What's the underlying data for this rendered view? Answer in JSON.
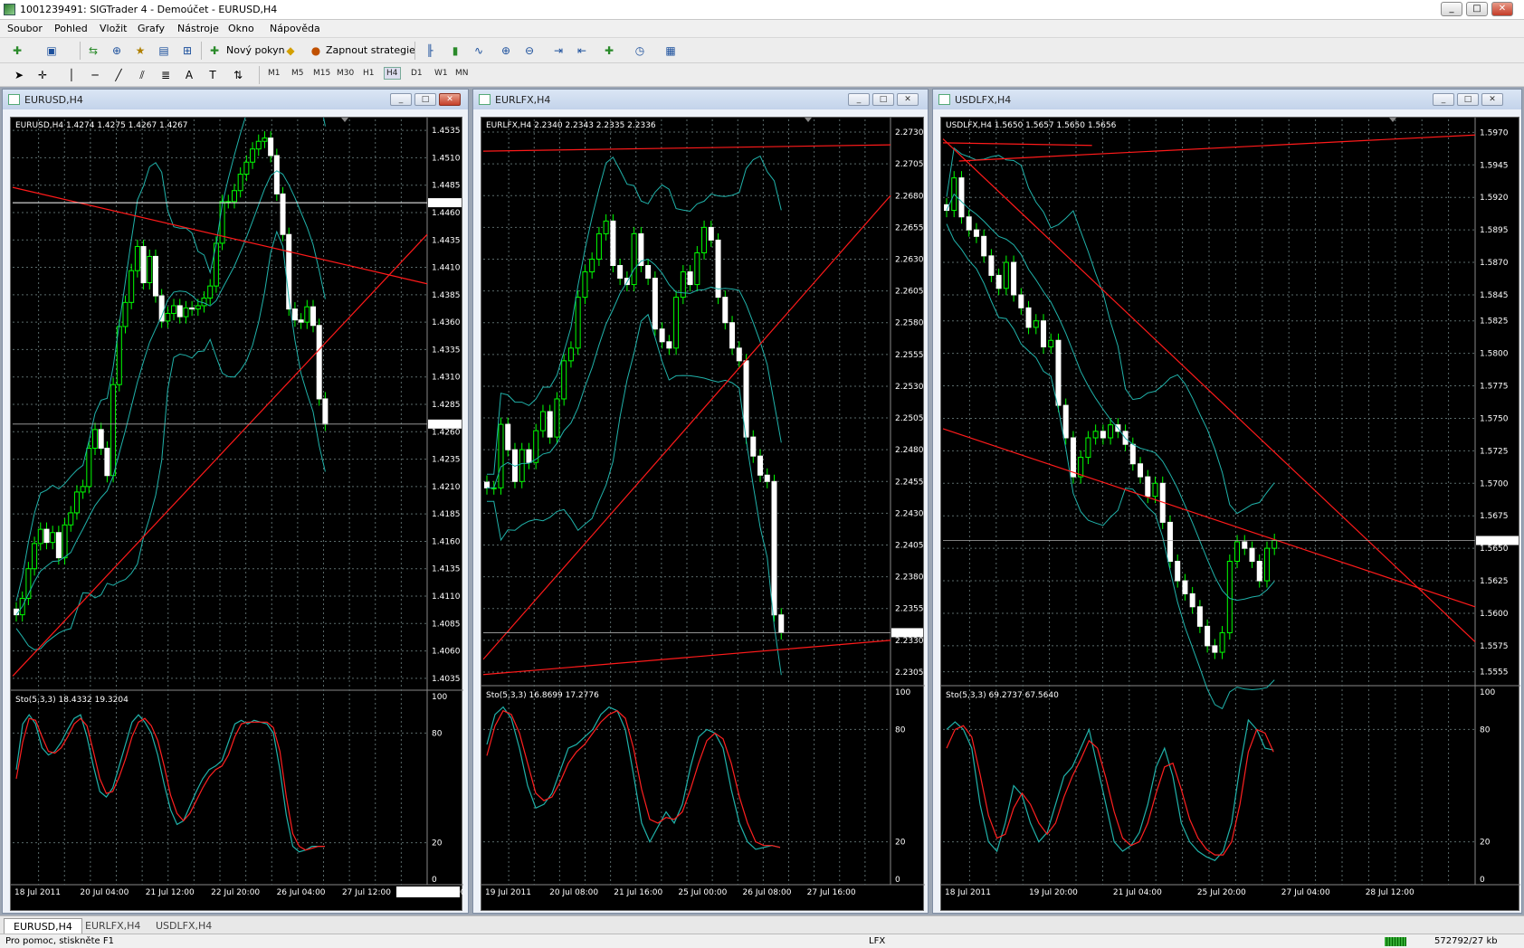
{
  "window": {
    "title": "1001239491: SIGTrader 4 - Demoúčet - EURUSD,H4",
    "min": "_",
    "max": "□",
    "close": "✕"
  },
  "menu": [
    "Soubor",
    "Pohled",
    "Vložit",
    "Grafy",
    "Nástroje",
    "Okno",
    "Nápověda"
  ],
  "toolbar": {
    "new_order": "Nový pokyn",
    "start_strategies": "Zapnout strategie",
    "timeframes": [
      "M1",
      "M5",
      "M15",
      "M30",
      "H1",
      "H4",
      "D1",
      "W1",
      "MN"
    ],
    "active_tf": "H4"
  },
  "charts": [
    {
      "caption": "EURUSD,H4",
      "info": "EURUSD,H4  1.4274 1.4275 1.4267 1.4267",
      "ylabels": [
        "1.4535",
        "1.4510",
        "1.4485",
        "1.4460",
        "1.4435",
        "1.4410",
        "1.4385",
        "1.4360",
        "1.4335",
        "1.4310",
        "1.4285",
        "1.4260",
        "1.4235",
        "1.4210",
        "1.4185",
        "1.4160",
        "1.4135",
        "1.4110",
        "1.4085",
        "1.4060",
        "1.4035"
      ],
      "ymax": 1.4545,
      "ymin": 1.4025,
      "ask": "1.4469",
      "bid": "1.4267",
      "sto": "Sto(5,3,3) 18.4332 19.3204",
      "xlabels": [
        "18 Jul 2011",
        "20 Jul 04:00",
        "21 Jul 12:00",
        "22 Jul 20:00",
        "26 Jul 04:00",
        "27 Jul 12:00"
      ],
      "xbox": "2011.07.31 0:00",
      "closes": [
        1.4093,
        1.4108,
        1.4135,
        1.4158,
        1.4171,
        1.4159,
        1.4168,
        1.4145,
        1.4175,
        1.4186,
        1.4205,
        1.421,
        1.4245,
        1.4262,
        1.4245,
        1.422,
        1.4303,
        1.4356,
        1.4378,
        1.4407,
        1.4429,
        1.4396,
        1.442,
        1.4384,
        1.4361,
        1.4368,
        1.4375,
        1.4365,
        1.4373,
        1.4372,
        1.4375,
        1.4382,
        1.4393,
        1.4432,
        1.447,
        1.447,
        1.448,
        1.4495,
        1.4506,
        1.4518,
        1.4525,
        1.4528,
        1.4512,
        1.4477,
        1.444,
        1.4372,
        1.4362,
        1.436,
        1.4374,
        1.4357,
        1.429,
        1.4267
      ],
      "trend_lines": [
        [
          1.4483,
          0,
          1.4395,
          1
        ],
        [
          1.4037,
          0,
          1.444,
          1
        ]
      ],
      "sto_k": [
        60,
        85,
        90,
        85,
        72,
        68,
        70,
        75,
        82,
        88,
        90,
        78,
        62,
        48,
        45,
        50,
        62,
        74,
        86,
        90,
        86,
        80,
        68,
        52,
        38,
        30,
        32,
        40,
        48,
        55,
        60,
        62,
        65,
        75,
        85,
        87,
        85,
        87,
        86,
        85,
        80,
        60,
        35,
        18,
        15,
        16,
        18,
        18,
        18
      ],
      "sto_d": [
        55,
        75,
        88,
        87,
        78,
        70,
        69,
        72,
        78,
        85,
        88,
        84,
        70,
        55,
        47,
        48,
        56,
        66,
        78,
        86,
        88,
        84,
        76,
        62,
        46,
        36,
        32,
        36,
        43,
        50,
        56,
        60,
        62,
        68,
        78,
        85,
        86,
        86,
        86,
        86,
        83,
        70,
        45,
        25,
        18,
        16,
        17,
        18,
        18
      ]
    },
    {
      "caption": "EURLFX,H4",
      "info": "EURLFX,H4  2.2340 2.2343 2.2335 2.2336",
      "ylabels": [
        "2.2730",
        "2.2705",
        "2.2680",
        "2.2655",
        "2.2630",
        "2.2605",
        "2.2580",
        "2.2555",
        "2.2530",
        "2.2505",
        "2.2480",
        "2.2455",
        "2.2430",
        "2.2405",
        "2.2380",
        "2.2355",
        "2.2330",
        "2.2305"
      ],
      "ymax": 2.274,
      "ymin": 2.2295,
      "ask": "",
      "bid": "2.2336",
      "sto": "Sto(5,3,3) 16.8699 17.2776",
      "xlabels": [
        "19 Jul 2011",
        "20 Jul 08:00",
        "21 Jul 16:00",
        "25 Jul 00:00",
        "26 Jul 08:00",
        "27 Jul 16:00"
      ],
      "xbox": "",
      "closes": [
        2.245,
        2.245,
        2.25,
        2.248,
        2.2455,
        2.248,
        2.247,
        2.2495,
        2.251,
        2.249,
        2.252,
        2.255,
        2.256,
        2.26,
        2.262,
        2.263,
        2.265,
        2.266,
        2.2625,
        2.2615,
        2.261,
        2.265,
        2.2625,
        2.2615,
        2.2575,
        2.2565,
        2.256,
        2.26,
        2.262,
        2.261,
        2.2635,
        2.2655,
        2.2645,
        2.26,
        2.258,
        2.256,
        2.255,
        2.249,
        2.2475,
        2.246,
        2.2455,
        2.235,
        2.2336
      ],
      "trend_lines": [
        [
          2.2315,
          0,
          2.268,
          1
        ],
        [
          2.2715,
          0,
          2.272,
          1
        ],
        [
          2.2303,
          0,
          2.233,
          1
        ]
      ],
      "sto_k": [
        72,
        88,
        92,
        86,
        70,
        50,
        38,
        40,
        46,
        58,
        70,
        72,
        76,
        80,
        88,
        92,
        90,
        80,
        56,
        30,
        20,
        28,
        36,
        30,
        40,
        60,
        76,
        80,
        78,
        70,
        48,
        30,
        20,
        16,
        17,
        18,
        17
      ],
      "sto_d": [
        66,
        82,
        90,
        88,
        78,
        62,
        46,
        42,
        44,
        52,
        62,
        68,
        72,
        78,
        84,
        88,
        90,
        86,
        70,
        48,
        32,
        30,
        33,
        32,
        36,
        48,
        62,
        74,
        78,
        75,
        62,
        44,
        30,
        20,
        18,
        18,
        17
      ]
    },
    {
      "caption": "USDLFX,H4",
      "info": "USDLFX,H4  1.5650 1.5657 1.5650 1.5656",
      "ylabels": [
        "1.5970",
        "1.5945",
        "1.5920",
        "1.5895",
        "1.5870",
        "1.5845",
        "1.5825",
        "1.5800",
        "1.5775",
        "1.5750",
        "1.5725",
        "1.5700",
        "1.5675",
        "1.5650",
        "1.5625",
        "1.5600",
        "1.5575",
        "1.5555"
      ],
      "ymax": 1.598,
      "ymin": 1.5545,
      "ask": "",
      "bid": "1.5656",
      "sto": "Sto(5,3,3) 69.2737 67.5640",
      "xlabels": [
        "18 Jul 2011",
        "19 Jul 20:00",
        "21 Jul 04:00",
        "25 Jul 20:00",
        "27 Jul 04:00",
        "28 Jul 12:00"
      ],
      "xbox": "",
      "closes": [
        1.591,
        1.5935,
        1.5905,
        1.5895,
        1.589,
        1.5875,
        1.586,
        1.585,
        1.587,
        1.5845,
        1.5835,
        1.582,
        1.5825,
        1.5805,
        1.581,
        1.576,
        1.5735,
        1.5705,
        1.572,
        1.5735,
        1.574,
        1.5735,
        1.5745,
        1.574,
        1.573,
        1.5715,
        1.5705,
        1.569,
        1.57,
        1.567,
        1.564,
        1.5625,
        1.5615,
        1.5605,
        1.559,
        1.5575,
        1.557,
        1.5585,
        1.564,
        1.5655,
        1.565,
        1.564,
        1.5625,
        1.565,
        1.5656
      ],
      "trend_lines": [
        [
          1.5962,
          0,
          1.596,
          0.28
        ],
        [
          1.5948,
          0.03,
          1.5968,
          1
        ],
        [
          1.5742,
          0,
          1.5605,
          1
        ],
        [
          1.5965,
          0,
          1.5578,
          1
        ]
      ],
      "sto_k": [
        80,
        84,
        80,
        70,
        40,
        20,
        15,
        30,
        50,
        45,
        30,
        20,
        25,
        40,
        55,
        60,
        70,
        80,
        60,
        40,
        20,
        15,
        18,
        25,
        40,
        60,
        70,
        55,
        30,
        20,
        15,
        12,
        10,
        15,
        30,
        60,
        85,
        80,
        70,
        69
      ],
      "sto_d": [
        70,
        80,
        82,
        76,
        56,
        34,
        22,
        24,
        38,
        46,
        40,
        30,
        24,
        30,
        44,
        55,
        64,
        74,
        70,
        54,
        36,
        22,
        18,
        20,
        30,
        46,
        60,
        62,
        48,
        32,
        22,
        16,
        13,
        13,
        20,
        40,
        68,
        80,
        78,
        68
      ]
    }
  ],
  "tabs": [
    "EURUSD,H4",
    "EURLFX,H4",
    "USDLFX,H4"
  ],
  "status": {
    "help": "Pro pomoc, stiskněte F1",
    "symbol": "LFX",
    "traffic": "572792/27 kb"
  },
  "colors": {
    "bull": "#00ff00",
    "bear": "#ffffff",
    "bands": "#20b2aa",
    "trend": "#ff1a1a",
    "sto_k": "#20b2aa",
    "sto_d": "#ff2020",
    "grid": "#5a6a6a"
  }
}
